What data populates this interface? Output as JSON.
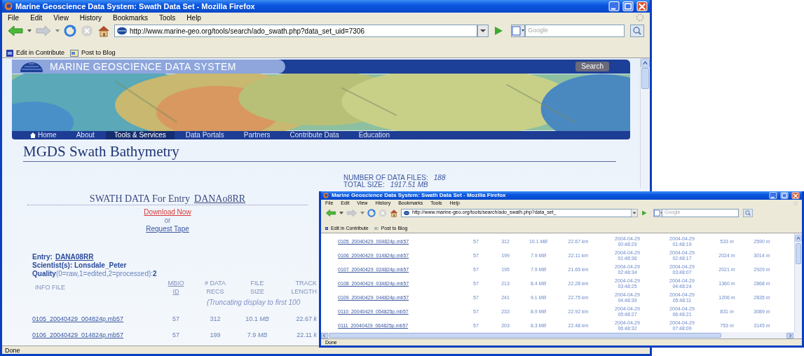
{
  "main_window": {
    "title": "Marine Geoscience Data System: Swath Data Set - Mozilla Firefox",
    "menu": [
      "File",
      "Edit",
      "View",
      "History",
      "Bookmarks",
      "Tools",
      "Help"
    ],
    "url": "http://www.marine-geo.org/tools/search/ado_swath.php?data_set_uid=7306",
    "search_placeholder": "Google",
    "bookmarks": [
      "Edit in Contribute",
      "Post to Blog"
    ],
    "site": {
      "logo_text": "MARINE GEOSCIENCE DATA SYSTEM",
      "search_button": "Search",
      "nav": [
        {
          "label": "Home",
          "selected": false
        },
        {
          "label": "About",
          "selected": false
        },
        {
          "label": "Tools & Services",
          "selected": true
        },
        {
          "label": "Data Portals",
          "selected": false
        },
        {
          "label": "Partners",
          "selected": false
        },
        {
          "label": "Contribute Data",
          "selected": false
        },
        {
          "label": "Education",
          "selected": false
        }
      ],
      "page_title": "MGDS Swath Bathymetry",
      "summary": [
        {
          "label": "NUMBER OF DATA FILES:",
          "value": "188"
        },
        {
          "label": "TOTAL SIZE:",
          "value": "1917.51 MB"
        }
      ],
      "heading": "SWATH DATA For Entry",
      "heading_link": "DANAo8RR",
      "download_link": "Download Now",
      "or": "or",
      "request_link": "Request Tape",
      "entry_label": "Entry:",
      "entry_value": "DANA08RR",
      "scientist": "Scientist(s): Lonsdale_Peter",
      "quality": "**Quality**(0=raw,1=edited,2=processed):**2**",
      "columns": [
        {
          "lines": [
            "INFO FILE"
          ],
          "link": false
        },
        {
          "lines": [
            "MBIO",
            "ID"
          ],
          "link": true
        },
        {
          "lines": [
            "# DATA",
            "RECS"
          ],
          "link": false
        },
        {
          "lines": [
            "FILE",
            "SIZE"
          ],
          "link": false
        },
        {
          "lines": [
            "TRACK",
            "LENGTH"
          ],
          "link": false
        }
      ],
      "note": "(Truncating display to first 100",
      "rows": [
        [
          "0105_20040429_004824p.mb57",
          "57",
          "312",
          "10.1 *MB*",
          "22.67 *k*"
        ],
        [
          "0106_20040429_014824p.mb57",
          "57",
          "199",
          "7.9 *MB*",
          "22.11 *k*"
        ]
      ]
    },
    "status": "Done"
  },
  "second_window": {
    "title": "Marine Geoscience Data System: Swath Data Set - Mozilla Firefox",
    "menu": [
      "File",
      "Edit",
      "View",
      "History",
      "Bookmarks",
      "Tools",
      "Help"
    ],
    "url": "http://www.marine-geo.org/tools/search/ado_swath.php?data_set_",
    "search_placeholder": "Google",
    "bookmarks": [
      "Edit in Contribute",
      "Post to Blog"
    ],
    "rows": [
      [
        "0105_20040429_004824p.mb57",
        "57",
        "312",
        "10.1 *MB*",
        "22.67 *km*",
        "2004-04-29\n00:48:29",
        "2004-04-29\n01:48:19",
        "533 *m*",
        "2590 *m*"
      ],
      [
        "0106_20040429_014824p.mb57",
        "57",
        "199",
        "7.9 *MB*",
        "22.11 *km*",
        "2004-04-29\n01:48:36",
        "2004-04-29\n02:48:17",
        "2024 *m*",
        "3014 *m*"
      ],
      [
        "0107_20040429_024824p.mb57",
        "57",
        "195",
        "7.9 *MB*",
        "21.65 *km*",
        "2004-04-29\n02:48:34",
        "2004-04-29\n03:48:07",
        "2021 *m*",
        "2929 *m*"
      ],
      [
        "0108_20040429_034824p.mb57",
        "57",
        "213",
        "8.4 *MB*",
        "22.28 *km*",
        "2004-04-29\n03:48:25",
        "2004-04-29\n04:48:24",
        "1360 *m*",
        "2868 *m*"
      ],
      [
        "0109_20040429_044824p.mb57",
        "57",
        "241",
        "9.1 *MB*",
        "22.75 *km*",
        "2004-04-29\n04:48:39",
        "2004-04-29\n05:48:11",
        "1206 *m*",
        "2835 *m*"
      ],
      [
        "0110_20040429_054825p.mb57",
        "57",
        "233",
        "8.9 *MB*",
        "22.92 *km*",
        "2004-04-29\n05:48:27",
        "2004-04-29\n06:48:21",
        "831 *m*",
        "3089 *m*"
      ],
      [
        "0111_20040429_064825p.mb57",
        "57",
        "203",
        "8.3 *MB*",
        "22.48 *km*",
        "2004-04-29\n06:48:32",
        "2004-04-29\n07:48:09",
        "753 *m*",
        "3145 *m*"
      ]
    ],
    "status": "Done"
  }
}
